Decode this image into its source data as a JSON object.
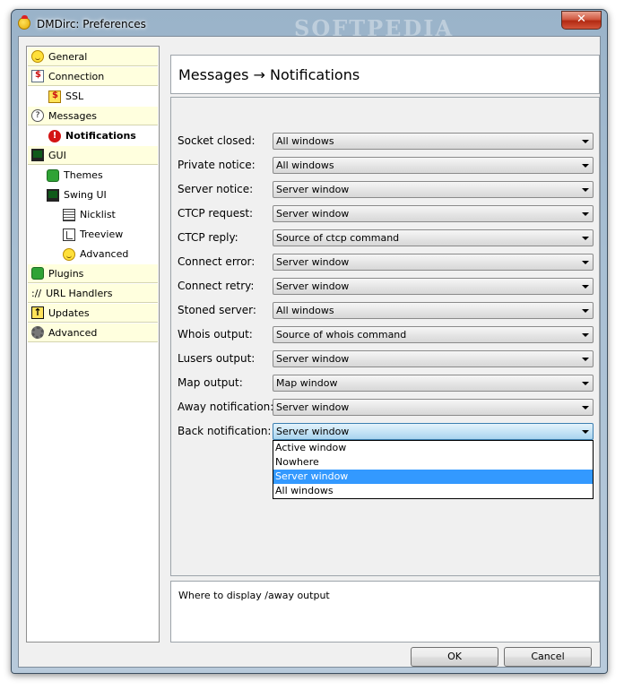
{
  "window": {
    "title": "DMDirc: Preferences",
    "watermark": "SOFTPEDIA",
    "close_glyph": "✕"
  },
  "sidebar": {
    "items": [
      {
        "label": "General",
        "icon": "smiley-icon"
      },
      {
        "label": "Connection",
        "icon": "connection-icon"
      },
      {
        "label": "SSL",
        "icon": "ssl-icon"
      },
      {
        "label": "Messages",
        "icon": "help-icon"
      },
      {
        "label": "Notifications",
        "icon": "alert-icon",
        "selected": true
      },
      {
        "label": "GUI",
        "icon": "monitor-icon"
      },
      {
        "label": "Themes",
        "icon": "puzzle-icon"
      },
      {
        "label": "Swing UI",
        "icon": "monitor-icon"
      },
      {
        "label": "Nicklist",
        "icon": "list-icon"
      },
      {
        "label": "Treeview",
        "icon": "tree-icon"
      },
      {
        "label": "Advanced",
        "icon": "smiley-icon"
      },
      {
        "label": "Plugins",
        "icon": "puzzle-icon"
      },
      {
        "label": "URL Handlers",
        "icon": "url-icon",
        "icon_text": "://"
      },
      {
        "label": "Updates",
        "icon": "update-icon"
      },
      {
        "label": "Advanced",
        "icon": "gear-icon"
      }
    ]
  },
  "header": {
    "title": "Messages → Notifications"
  },
  "rows": [
    {
      "label": "Socket closed:",
      "value": "All windows"
    },
    {
      "label": "Private notice:",
      "value": "All windows"
    },
    {
      "label": "Server notice:",
      "value": "Server window"
    },
    {
      "label": "CTCP request:",
      "value": "Server window"
    },
    {
      "label": "CTCP reply:",
      "value": "Source of ctcp command"
    },
    {
      "label": "Connect error:",
      "value": "Server window"
    },
    {
      "label": "Connect retry:",
      "value": "Server window"
    },
    {
      "label": "Stoned server:",
      "value": "All windows"
    },
    {
      "label": "Whois output:",
      "value": "Source of whois command"
    },
    {
      "label": "Lusers output:",
      "value": "Server window"
    },
    {
      "label": "Map output:",
      "value": "Map window"
    },
    {
      "label": "Away notification:",
      "value": "Server window"
    },
    {
      "label": "Back notification:",
      "value": "Server window"
    }
  ],
  "dropdown": {
    "options": [
      "Active window",
      "Nowhere",
      "Server window",
      "All windows"
    ],
    "selected": "Server window"
  },
  "description": "Where to display /away output",
  "buttons": {
    "ok": "OK",
    "cancel": "Cancel"
  }
}
